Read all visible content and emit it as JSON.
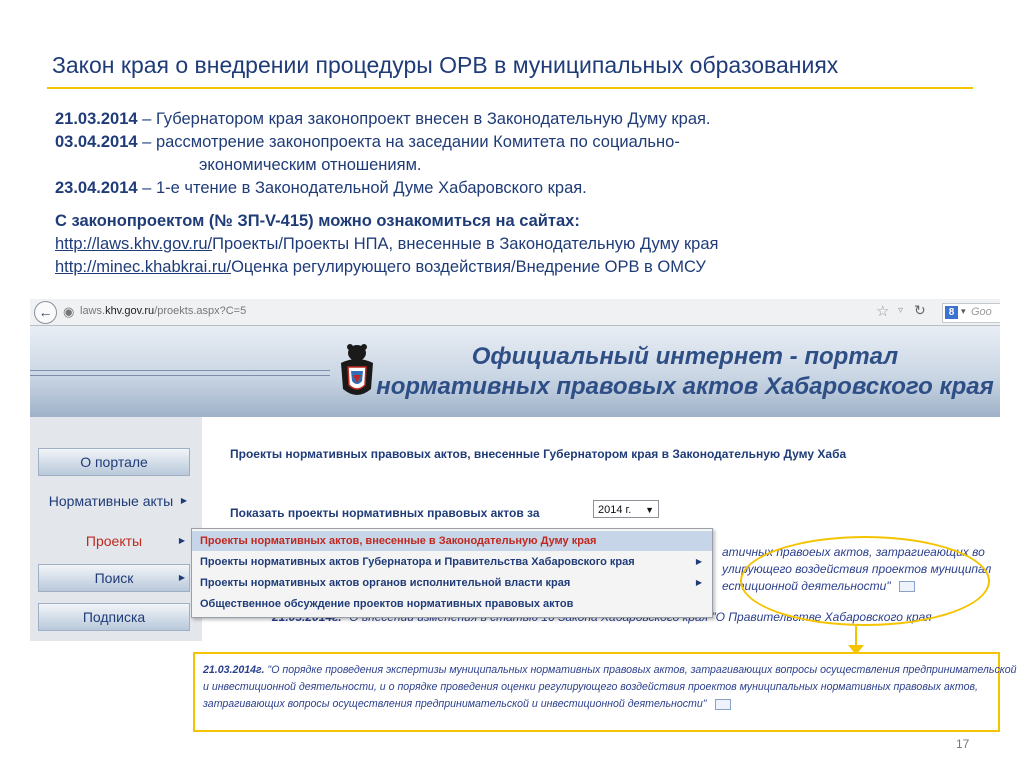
{
  "slide": {
    "title": "Закон края о внедрении процедуры ОРВ в муниципальных образованиях",
    "timeline": [
      {
        "date": "21.03.2014",
        "text": " – Губернатором края законопроект внесен в Законодательную Думу края."
      },
      {
        "date": "03.04.2014",
        "text": " – рассмотрение законопроекта на заседании Комитета по   социально-",
        "cont": "экономическим отношениям."
      },
      {
        "date": "23.04.2014",
        "text": " – 1-е чтение в Законодательной Думе Хабаровского края."
      }
    ],
    "sites_heading": "С законопроектом (№ ЗП-V-415) можно ознакомиться на сайтах:",
    "links": [
      {
        "url": "http://laws.khv.gov.ru/",
        "path": "Проекты/Проекты НПА, внесенные в Законодательную Думу края"
      },
      {
        "url": "http://minec.khabkrai.ru/",
        "path": "Оценка регулирующего воздействия/Внедрение ОРВ в ОМСУ"
      }
    ],
    "page_number": "17"
  },
  "browser": {
    "url_prefix": "laws.",
    "url_domain": "khv.gov.ru",
    "url_path": "/proekts.aspx?C=5",
    "search_engine_label": "Goo",
    "icons": {
      "back": "back-arrow-icon",
      "site": "globe-icon",
      "bookmark": "star-icon",
      "reload": "reload-icon"
    }
  },
  "portal": {
    "title_line1": "Официальный интернет - портал",
    "title_line2": "нормативных правовых актов Хабаровского края"
  },
  "sidebar": {
    "items": [
      {
        "label": "О портале"
      },
      {
        "label": "Нормативные акты"
      },
      {
        "label": "Проекты"
      },
      {
        "label": "Поиск"
      },
      {
        "label": "Подписка"
      }
    ]
  },
  "content": {
    "heading": "Проекты нормативных правовых актов, внесенные Губернатором края в Законодательную Думу Хаба",
    "show_label": "Показать проекты нормативных правовых актов за",
    "year_value": "2014 г.",
    "bg_lines": [
      "атичных правоеых актов, затрагиеающих во",
      "улирующего воздействия проектов муниципал",
      "естиционной деятельности\""
    ],
    "bg_date": "21.03.2014г.",
    "bg_date_text": " \"О внесении изменения в статью 16 Закона Хабаровского края \"О Правительстве Хабаровского края"
  },
  "dropdown": {
    "items": [
      {
        "label": "Проекты нормативных актов, внесенные в Законодательную Думу края",
        "has_sub": false
      },
      {
        "label": "Проекты нормативных актов Губернатора и Правительства Хабаровского края",
        "has_sub": true
      },
      {
        "label": "Проекты нормативных актов органов исполнительной власти края",
        "has_sub": true
      },
      {
        "label": "Общественное обсуждение проектов нормативных правовых актов",
        "has_sub": false
      }
    ]
  },
  "callout": {
    "date": "21.03.2014г.",
    "line1": " \"О порядке проведения экспертизы муниципальных нормативных правовых актов, затрагивающих вопросы осуществления предпринимательской",
    "line2": "и инвестиционной деятельности, и о порядке проведения оценки регулирующего воздействия проектов муниципальных нормативных правовых актов,",
    "line3": "затрагивающих вопросы осуществления предпринимательской и инвестиционной деятельности\""
  },
  "colors": {
    "accent": "#f5c400",
    "text": "#1f3c78",
    "highlight": "#c0281f"
  }
}
